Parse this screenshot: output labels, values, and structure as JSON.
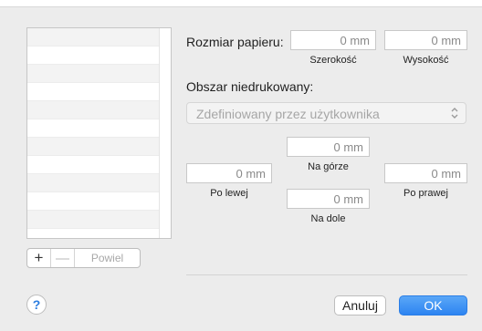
{
  "paper_size": {
    "label": "Rozmiar papieru:",
    "width_value": "0 mm",
    "width_label": "Szerokość",
    "height_value": "0 mm",
    "height_label": "Wysokość"
  },
  "margins": {
    "label": "Obszar niedrukowany:",
    "printer_select": "Zdefiniowany przez użytkownika",
    "top_value": "0 mm",
    "top_label": "Na górze",
    "left_value": "0 mm",
    "left_label": "Po lewej",
    "right_value": "0 mm",
    "right_label": "Po prawej",
    "bottom_value": "0 mm",
    "bottom_label": "Na dole"
  },
  "list_toolbar": {
    "add": "+",
    "remove": "—",
    "duplicate": "Powiel"
  },
  "footer": {
    "help": "?",
    "cancel": "Anuluj",
    "ok": "OK"
  },
  "colors": {
    "accent": "#2d84f1",
    "background": "#ececec"
  }
}
